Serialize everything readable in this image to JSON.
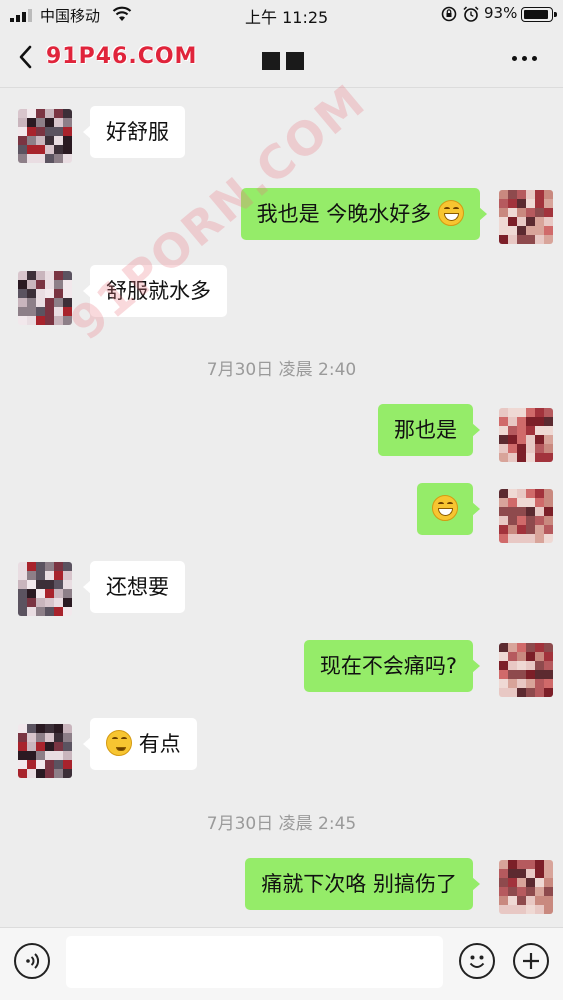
{
  "status_bar": {
    "carrier": "中国移动",
    "time": "上午 11:25",
    "battery": "93%",
    "battery_level": 0.93,
    "icons": [
      "signal-icon",
      "wifi-icon",
      "rotation-lock-icon",
      "alarm-icon",
      "battery-icon"
    ]
  },
  "nav": {
    "back_icon": "chevron-left-icon",
    "watermark": "91P46.COM",
    "more_icon": "more-dots-icon"
  },
  "watermark_center": "91PORN.COM",
  "messages": [
    {
      "side": "in",
      "text": "好舒服"
    },
    {
      "side": "out",
      "text": "我也是 今晚水好多",
      "emoji_after": "grinning-face-icon"
    },
    {
      "side": "in",
      "text": "舒服就水多"
    },
    {
      "type": "time",
      "text": "7月30日 凌晨 2:40"
    },
    {
      "side": "out",
      "text": "那也是"
    },
    {
      "side": "out",
      "text": "",
      "emoji_only": "grinning-face-icon"
    },
    {
      "side": "in",
      "text": "还想要"
    },
    {
      "side": "out",
      "text": "现在不会痛吗?"
    },
    {
      "side": "in",
      "text": "有点",
      "emoji_before": "thinking-face-icon"
    },
    {
      "type": "time",
      "text": "7月30日 凌晨 2:45"
    },
    {
      "side": "out",
      "text": "痛就下次咯 别搞伤了"
    }
  ],
  "input_bar": {
    "icons": [
      "voice-icon",
      "emoji-icon",
      "plus-icon"
    ],
    "text_value": ""
  },
  "colors": {
    "background": "#ededed",
    "outgoing_bubble": "#95ec69",
    "incoming_bubble": "#ffffff",
    "timestamp": "#9a9a9a",
    "watermark": "#e0243b"
  }
}
